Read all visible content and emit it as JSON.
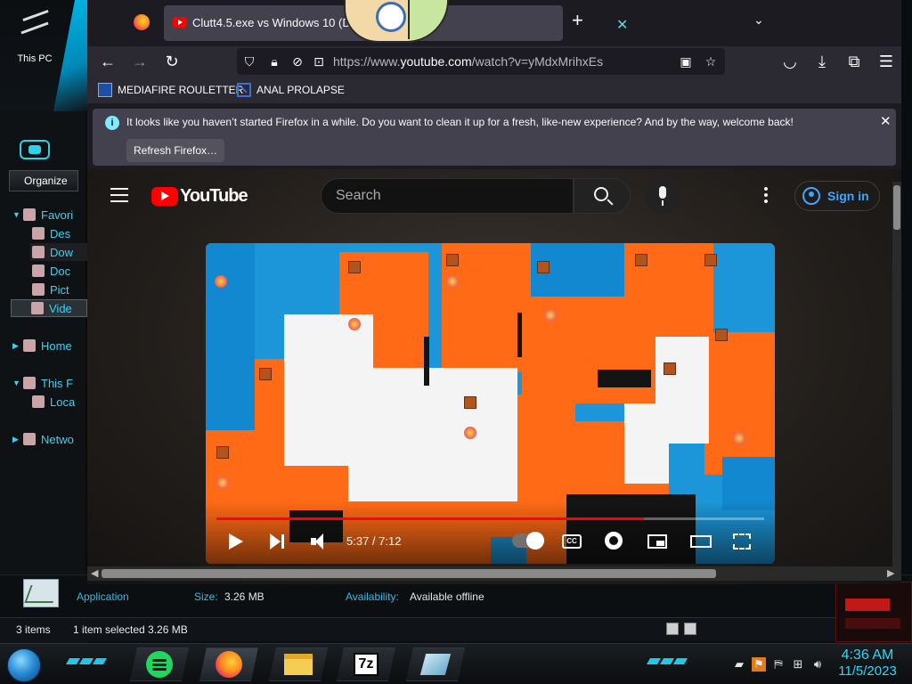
{
  "desktop": {
    "this_pc_label": "This PC"
  },
  "explorer": {
    "organize_label": "Organize",
    "nav": [
      {
        "label": "Favori",
        "level": 0
      },
      {
        "label": "Des",
        "level": 1
      },
      {
        "label": "Dow",
        "level": 1,
        "selected": false
      },
      {
        "label": "Doc",
        "level": 1
      },
      {
        "label": "Pict",
        "level": 1
      },
      {
        "label": "Vide",
        "level": 1,
        "selected": true
      },
      {
        "label": "Home",
        "level": 0
      },
      {
        "label": "This F",
        "level": 0
      },
      {
        "label": "Loca",
        "level": 1
      },
      {
        "label": "Netwo",
        "level": 0
      }
    ],
    "details": {
      "type": "Application",
      "size_key": "Size:",
      "size_value": "3.26 MB",
      "availability_key": "Availability:",
      "availability_value": "Available offline"
    },
    "status": {
      "item_count": "3 items",
      "selection": "1 item selected  3.26 MB"
    }
  },
  "browser": {
    "tab": {
      "title": "Clutt4.5.exe vs Windows 10 (Do"
    },
    "address": {
      "prefix": "https://www.",
      "host": "youtube.com",
      "path": "/watch?v=yMdxMrihxEs"
    },
    "bookmarks": [
      {
        "label": "MEDIAFIRE ROULETTER",
        "icon": "mediafire-icon"
      },
      {
        "label": "ANAL PROLAPSE",
        "icon": "sigma-icon"
      }
    ],
    "notification": {
      "message": "It looks like you haven’t started Firefox in a while. Do you want to clean it up for a fresh, like-new experience? And by the way, welcome back!",
      "button": "Refresh Firefox…"
    }
  },
  "youtube": {
    "logo_text": "YouTube",
    "search_placeholder": "Search",
    "sign_in": "Sign in",
    "player": {
      "current": "5:37",
      "duration": "7:12",
      "time_display": "5:37 / 7:12",
      "progress_fraction": 0.78,
      "cc_label": "CC"
    }
  },
  "taskbar": {
    "apps": [
      "spotify",
      "firefox",
      "file-explorer",
      "7-zip",
      "glass-app"
    ],
    "zip_label": "7z",
    "clock_time": "4:36 AM",
    "clock_date": "11/5/2023"
  },
  "colors": {
    "accent_cyan": "#2fd7f5",
    "youtube_red": "#ff0000",
    "firefox_dark": "#1c1b22",
    "video_orange": "#ff6a16"
  }
}
